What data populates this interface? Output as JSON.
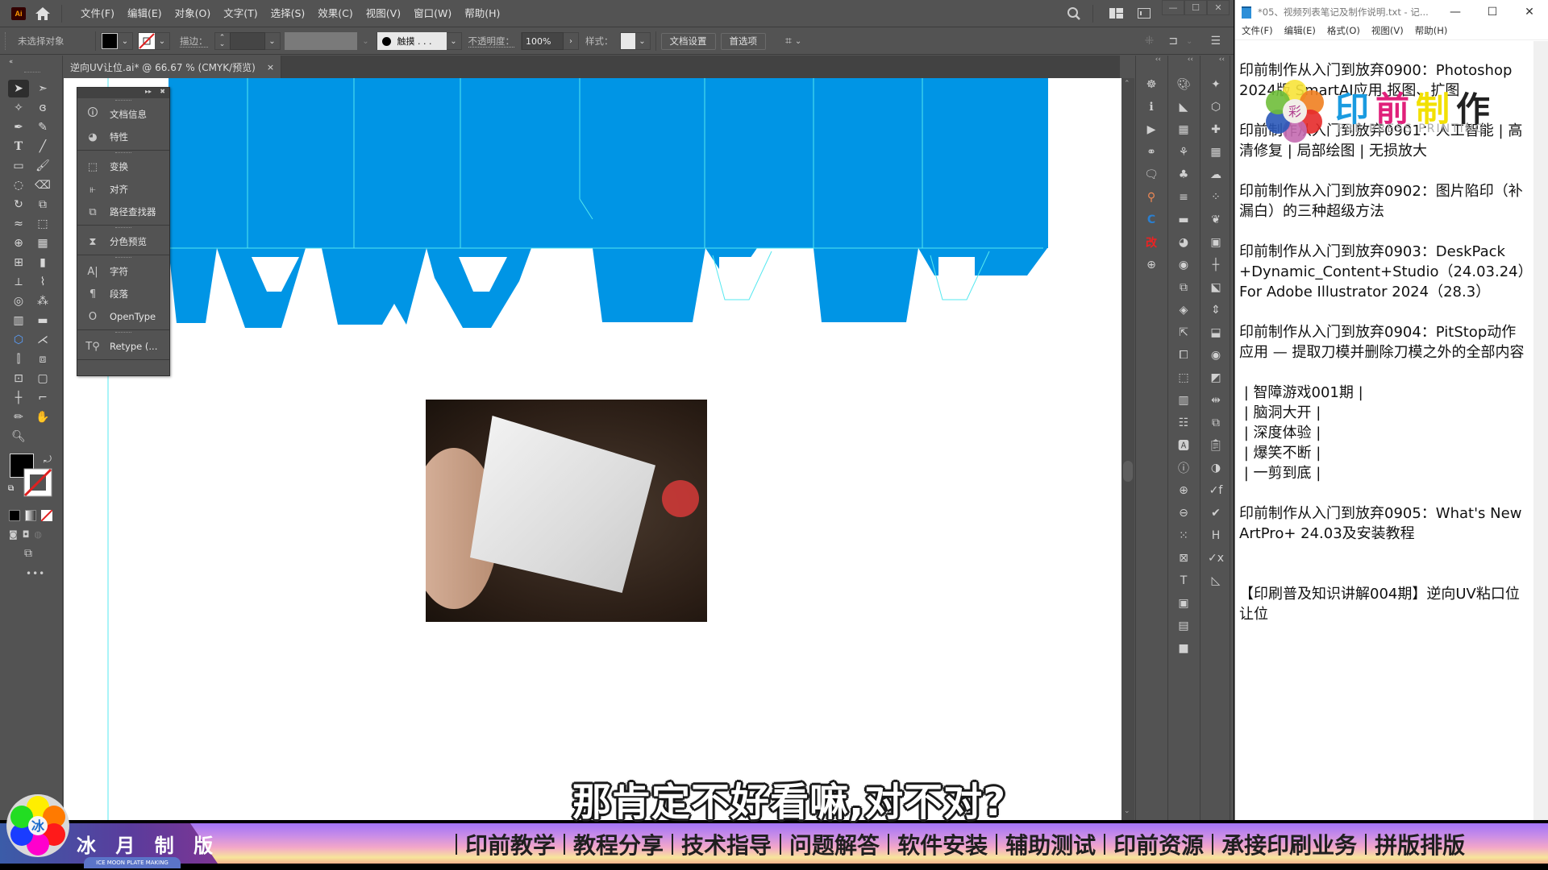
{
  "illustrator": {
    "app_icon": "Ai",
    "menu": [
      "文件(F)",
      "编辑(E)",
      "对象(O)",
      "文字(T)",
      "选择(S)",
      "效果(C)",
      "视图(V)",
      "窗口(W)",
      "帮助(H)"
    ],
    "control_bar": {
      "selection_status": "未选择对象",
      "stroke_label": "描边：",
      "brush_label": "触摸 . . .",
      "opacity_label": "不透明度：",
      "opacity_value": "100%",
      "style_label": "样式：",
      "doc_setup_button": "文档设置",
      "preferences_button": "首选项"
    },
    "document_tab": {
      "title": "逆向UV让位.ai* @ 66.67 % (CMYK/预览)",
      "close": "×"
    },
    "floating_panel": {
      "groups": [
        [
          {
            "icon": "document-info-icon",
            "label": "文档信息"
          },
          {
            "icon": "attributes-icon",
            "label": "特性"
          }
        ],
        [
          {
            "icon": "transform-icon",
            "label": "变换"
          },
          {
            "icon": "align-icon",
            "label": "对齐"
          },
          {
            "icon": "pathfinder-icon",
            "label": "路径查找器"
          }
        ],
        [
          {
            "icon": "separations-preview-icon",
            "label": "分色预览"
          }
        ],
        [
          {
            "icon": "character-icon",
            "label": "字符"
          },
          {
            "icon": "paragraph-icon",
            "label": "段落"
          },
          {
            "icon": "opentype-icon",
            "label": "OpenType"
          }
        ],
        [
          {
            "icon": "retype-icon",
            "label": "Retype (..."
          }
        ]
      ]
    },
    "canvas": {
      "artwork_fill": "#0095e5",
      "dieline_color": "#55e8f0"
    }
  },
  "notepad": {
    "title": "*05、视频列表笔记及制作说明.txt - 记...",
    "menu": [
      "文件(F)",
      "编辑(E)",
      "格式(O)",
      "视图(V)",
      "帮助(H)"
    ],
    "controls": {
      "minimize": "—",
      "maximize": "☐",
      "close": "✕"
    },
    "content": "印前制作从入门到放弃0900：Photoshop 2024版 SmartAI应用 抠图、扩图\n\n印前制作从入门到放弃0901：人工智能 | 高清修复 | 局部绘图 | 无损放大\n\n印前制作从入门到放弃0902：图片陷印（补漏白）的三种超级方法\n\n印前制作从入门到放弃0903：DeskPack +Dynamic_Content+Studio（24.03.24）For Adobe Illustrator 2024（28.3）\n\n印前制作从入门到放弃0904：PitStop动作应用 — 提取刀模并删除刀模之外的全部内容\n\n | 智障游戏001期 |\n | 脑洞大开 |\n | 深度体验 |\n | 爆笑不断 |\n | 一剪到底 |\n\n印前制作从入门到放弃0905：What's New ArtPro+ 24.03及安装教程\n\n\n【印刷普及知识讲解004期】逆向UV粘口位让位"
  },
  "watermark": {
    "text": [
      "印",
      "前",
      "制",
      "作"
    ],
    "colors": [
      "#1a9be0",
      "#e0207a",
      "#f2e000",
      "#222222"
    ],
    "subtitle": "PRE-PRESS PRINTING",
    "center_char": "彩"
  },
  "banner": {
    "brand_cn": "冰 月 制 版",
    "brand_en": "ICE MOON PLATE MAKING",
    "brand_char": "冰",
    "tags": [
      "印前教学",
      "教程分享",
      "技术指导",
      "问题解答",
      "软件安装",
      "辅助测试",
      "印前资源",
      "承接印刷业务",
      "拼版排版"
    ]
  },
  "subtitle": "那肯定不好看嘛,对不对?"
}
